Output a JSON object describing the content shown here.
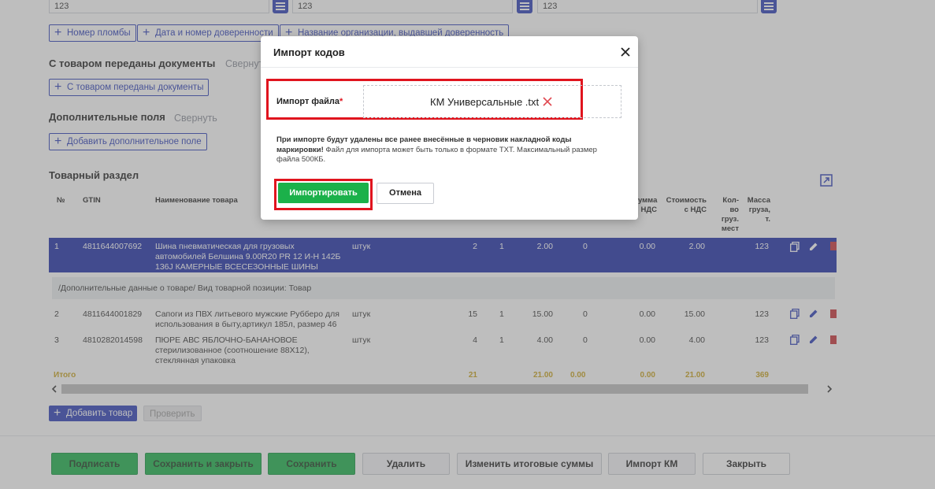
{
  "top_fields": [
    "123",
    "123",
    "123"
  ],
  "seal_buttons": {
    "seal_number": "Номер пломбы",
    "proxy_date_number": "Дата и номер доверенности",
    "proxy_org": "Название организации, выдавшей доверенность"
  },
  "documents_section": {
    "title": "С товаром переданы документы",
    "collapse": "Свернуть",
    "add_button": "С товаром переданы документы"
  },
  "extra_fields_section": {
    "title": "Дополнительные поля",
    "collapse": "Свернуть",
    "add_button": "Добавить дополнительное поле"
  },
  "goods_section": {
    "title": "Товарный раздел",
    "columns": {
      "num": "№",
      "gtin": "GTIN",
      "name": "Наименование товара",
      "vat_sum_1": "умма",
      "vat_sum_2": "НДС",
      "cost_1": "Стоимость",
      "cost_2": "с НДС",
      "places_1": "Кол-",
      "places_2": "во",
      "places_3": "груз.",
      "places_4": "мест",
      "mass_1": "Масса",
      "mass_2": "груза,",
      "mass_3": "т."
    },
    "rows": [
      {
        "num": "1",
        "gtin": "4811644007692",
        "name_1": "Шина пневматическая для грузовых",
        "name_2": "автомобилей Белшина 9.00R20 PR 12 И-Н 142Б",
        "name_3": "136J КАМЕРНЫЕ ВСЕСЕЗОННЫЕ ШИНЫ",
        "unit": "штук",
        "qty": "2",
        "c2": "1",
        "price": "2.00",
        "c4": "0",
        "vat": "0.00",
        "cost": "2.00",
        "mass": "123"
      },
      {
        "num": "2",
        "gtin": "4811644001829",
        "name_1": "Сапоги из ПВХ литьевого мужские Рубберо для",
        "name_2": "использования в быту,артикул 185л, размер 46",
        "unit": "штук",
        "qty": "15",
        "c2": "1",
        "price": "15.00",
        "c4": "0",
        "vat": "0.00",
        "cost": "15.00",
        "mass": "123"
      },
      {
        "num": "3",
        "gtin": "4810282014598",
        "name_1": "ПЮРЕ АВС ЯБЛОЧНО-БАНАНОВОЕ",
        "name_2": "стерилизованное (соотношение 88Х12),",
        "name_3": "стеклянная упаковка",
        "unit": "штук",
        "qty": "4",
        "c2": "1",
        "price": "4.00",
        "c4": "0",
        "vat": "0.00",
        "cost": "4.00",
        "mass": "123"
      }
    ],
    "subrow": "/Дополнительные данные о товаре/ Вид товарной позиции: Товар",
    "totals": {
      "label": "Итого",
      "qty": "21",
      "price": "21.00",
      "c4": "0.00",
      "vat": "0.00",
      "cost": "21.00",
      "mass": "369"
    },
    "add_button": "Добавить товар",
    "check_button": "Проверить"
  },
  "footer": {
    "sign": "Подписать",
    "save_close": "Сохранить и закрыть",
    "save": "Сохранить",
    "delete": "Удалить",
    "change_totals": "Изменить итоговые суммы",
    "import_km": "Импорт КМ",
    "close": "Закрыть"
  },
  "modal": {
    "title": "Импорт кодов",
    "file_label": "Импорт файла",
    "required_mark": "*",
    "file_name": "КМ Универсальные .txt",
    "note_bold": "При импорте будут удалены все ранее внесённые в черновик накладной коды маркировки!",
    "note_rest": " Файл для импорта может быть только в формате TXT. Максимальный размер файла 500КБ.",
    "import_button": "Импортировать",
    "cancel_button": "Отмена"
  },
  "colors": {
    "accent": "#2c3fb8",
    "selected_row": "#1e2ea8",
    "green": "#1bb14a",
    "highlight": "#e0141e",
    "totals": "#c9a21c"
  }
}
